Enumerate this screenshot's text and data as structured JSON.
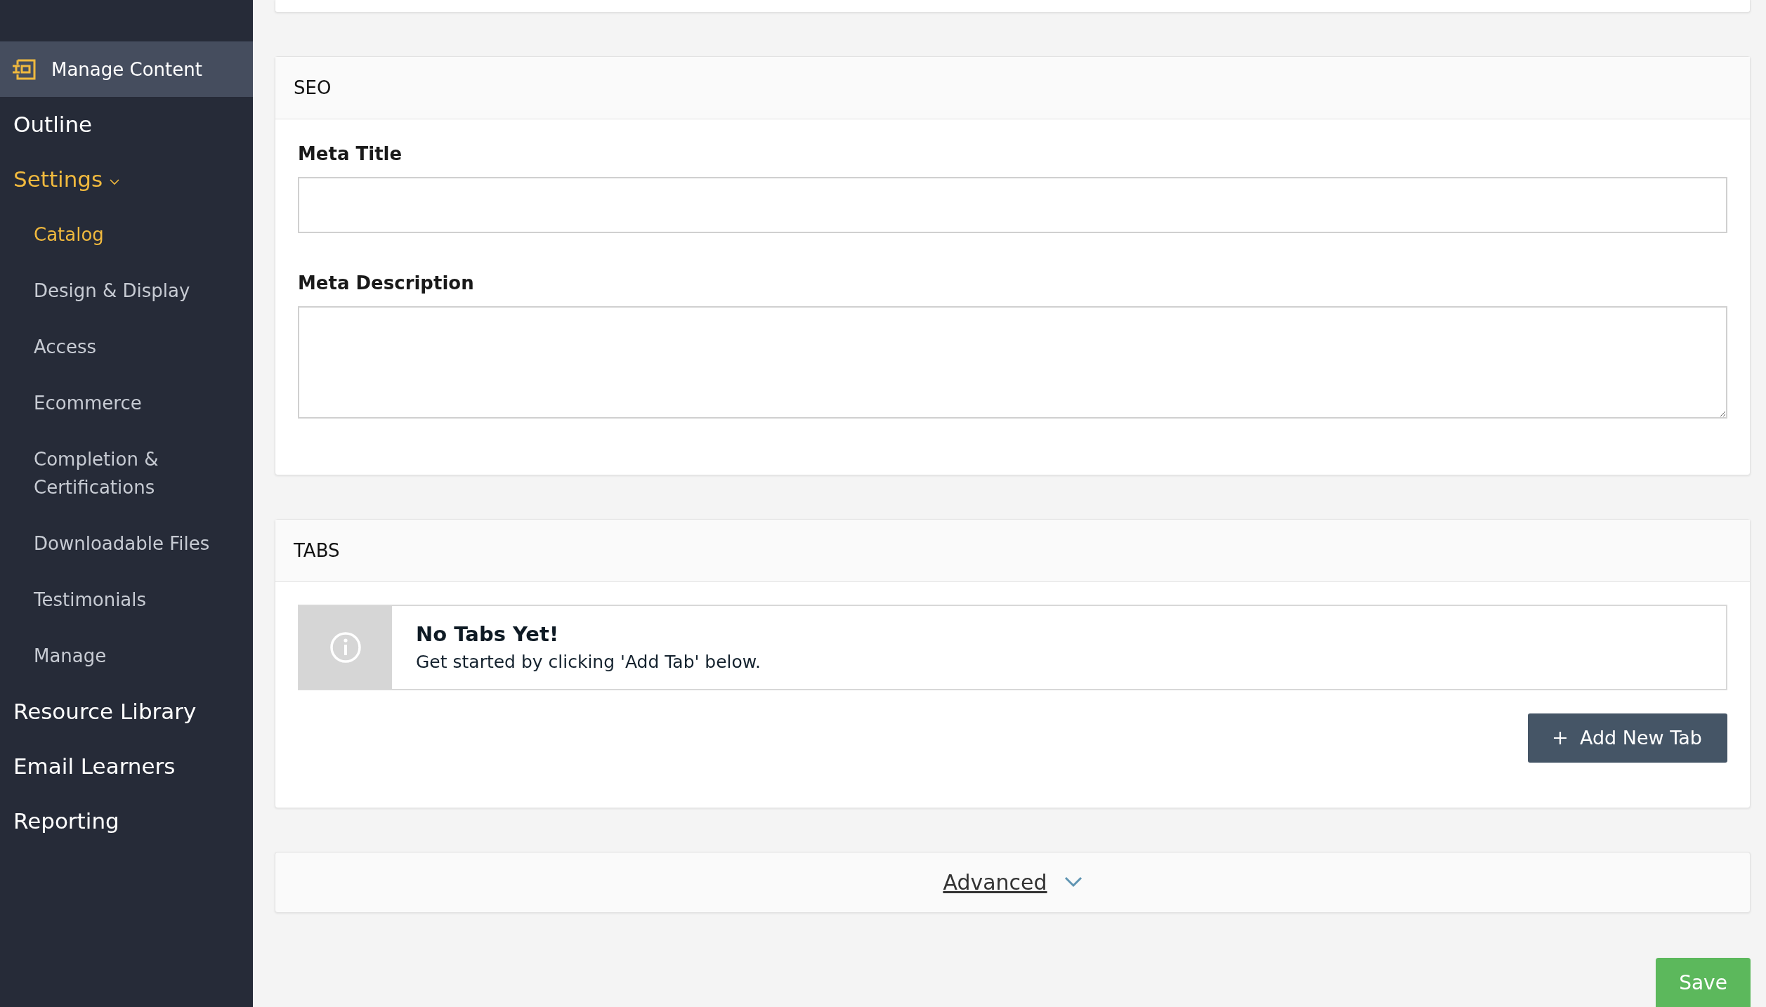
{
  "sidebar": {
    "header": {
      "label": "Manage Content",
      "selected": true
    },
    "items": [
      {
        "label": "Outline",
        "selected": false
      },
      {
        "label": "Settings",
        "selected": true,
        "expanded": true,
        "children": [
          {
            "label": "Catalog",
            "selected": true
          },
          {
            "label": "Design & Display",
            "selected": false
          },
          {
            "label": "Access",
            "selected": false
          },
          {
            "label": "Ecommerce",
            "selected": false
          },
          {
            "label": "Completion & Certifications",
            "selected": false
          },
          {
            "label": "Downloadable Files",
            "selected": false
          },
          {
            "label": "Testimonials",
            "selected": false
          },
          {
            "label": "Manage",
            "selected": false
          }
        ]
      },
      {
        "label": "Resource Library",
        "selected": false
      },
      {
        "label": "Email Learners",
        "selected": false
      },
      {
        "label": "Reporting",
        "selected": false
      }
    ]
  },
  "seo": {
    "title": "SEO",
    "fields": [
      {
        "kind": "input",
        "label": "Meta Title"
      },
      {
        "kind": "textarea",
        "label": "Meta Description"
      }
    ]
  },
  "tabs": {
    "title": "TABS",
    "notice": {
      "title": "No Tabs Yet!",
      "text": "Get started by clicking 'Add Tab' below."
    },
    "add_button": "Add New Tab"
  },
  "advanced": {
    "label": "Advanced",
    "expanded": false
  },
  "save_button": "Save"
}
